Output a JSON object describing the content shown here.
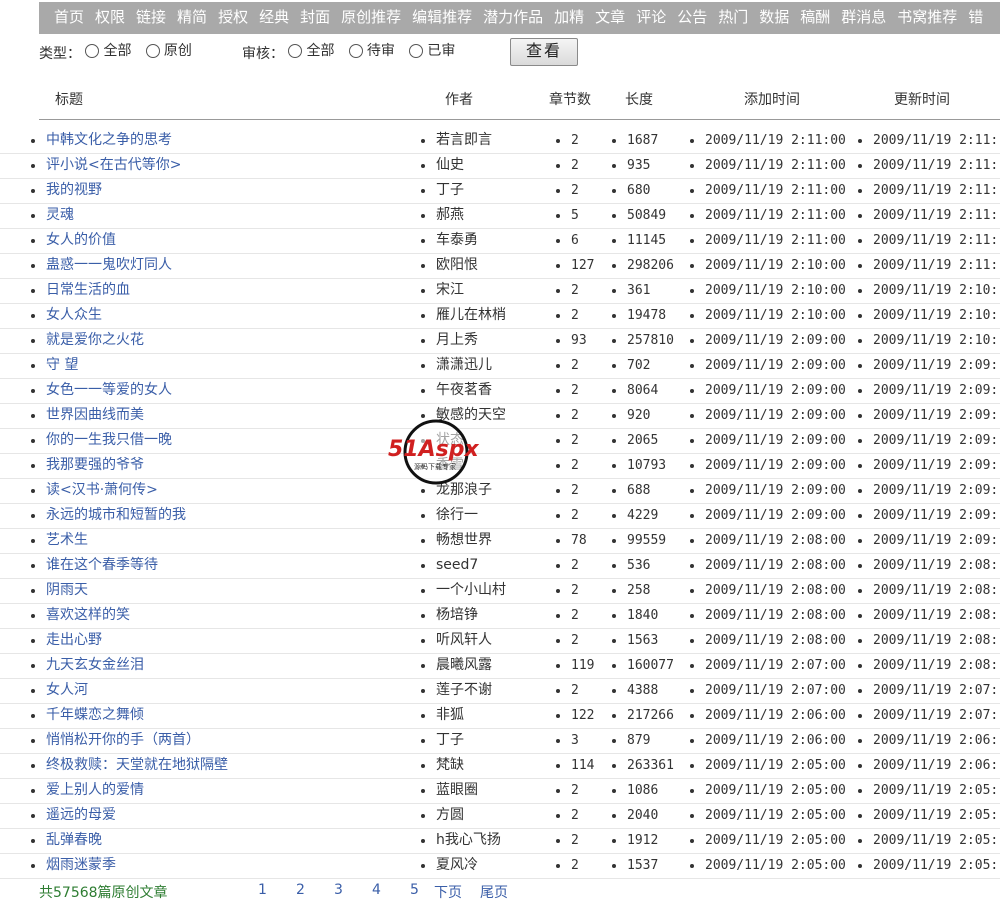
{
  "nav": [
    "首页",
    "权限",
    "链接",
    "精简",
    "授权",
    "经典",
    "封面",
    "原创推荐",
    "编辑推荐",
    "潜力作品",
    "加精",
    "文章",
    "评论",
    "公告",
    "热门",
    "数据",
    "稿酬",
    "群消息",
    "书窝推荐",
    "错"
  ],
  "filters": {
    "type_label": "类型：",
    "type_options": [
      "全部",
      "原创"
    ],
    "review_label": "审核：",
    "review_options": [
      "全部",
      "待审",
      "已审"
    ],
    "view_button": "查看"
  },
  "headers": {
    "title": "标题",
    "author": "作者",
    "chapters": "章节数",
    "length": "长度",
    "added": "添加时间",
    "updated": "更新时间"
  },
  "rows": [
    {
      "title": "中韩文化之争的思考",
      "author": "若言即言",
      "chapters": "2",
      "length": "1687",
      "added": "2009/11/19 2:11:00",
      "updated": "2009/11/19 2:11:"
    },
    {
      "title": "评小说<在古代等你>",
      "author": "仙史",
      "chapters": "2",
      "length": "935",
      "added": "2009/11/19 2:11:00",
      "updated": "2009/11/19 2:11:"
    },
    {
      "title": "我的视野",
      "author": "丁子",
      "chapters": "2",
      "length": "680",
      "added": "2009/11/19 2:11:00",
      "updated": "2009/11/19 2:11:"
    },
    {
      "title": "灵魂",
      "author": "郝燕",
      "chapters": "5",
      "length": "50849",
      "added": "2009/11/19 2:11:00",
      "updated": "2009/11/19 2:11:"
    },
    {
      "title": "女人的价值",
      "author": "车泰勇",
      "chapters": "6",
      "length": "11145",
      "added": "2009/11/19 2:11:00",
      "updated": "2009/11/19 2:11:"
    },
    {
      "title": "蛊惑一一鬼吹灯同人",
      "author": "欧阳恨",
      "chapters": "127",
      "length": "298206",
      "added": "2009/11/19 2:10:00",
      "updated": "2009/11/19 2:11:"
    },
    {
      "title": "日常生活的血",
      "author": "宋江",
      "chapters": "2",
      "length": "361",
      "added": "2009/11/19 2:10:00",
      "updated": "2009/11/19 2:10:"
    },
    {
      "title": "女人众生",
      "author": "雁儿在林梢",
      "chapters": "2",
      "length": "19478",
      "added": "2009/11/19 2:10:00",
      "updated": "2009/11/19 2:10:"
    },
    {
      "title": "就是爱你之火花",
      "author": "月上秀",
      "chapters": "93",
      "length": "257810",
      "added": "2009/11/19 2:09:00",
      "updated": "2009/11/19 2:10:"
    },
    {
      "title": "守 望",
      "author": "潇潇迅儿",
      "chapters": "2",
      "length": "702",
      "added": "2009/11/19 2:09:00",
      "updated": "2009/11/19 2:09:"
    },
    {
      "title": "女色一一等爱的女人",
      "author": "午夜茗香",
      "chapters": "2",
      "length": "8064",
      "added": "2009/11/19 2:09:00",
      "updated": "2009/11/19 2:09:"
    },
    {
      "title": "世界因曲线而美",
      "author": "敏感的天空",
      "chapters": "2",
      "length": "920",
      "added": "2009/11/19 2:09:00",
      "updated": "2009/11/19 2:09:"
    },
    {
      "title": "你的一生我只借一晚",
      "author": "状态",
      "chapters": "2",
      "length": "2065",
      "added": "2009/11/19 2:09:00",
      "updated": "2009/11/19 2:09:"
    },
    {
      "title": "我那要强的爷爷",
      "author": "香雪",
      "chapters": "2",
      "length": "10793",
      "added": "2009/11/19 2:09:00",
      "updated": "2009/11/19 2:09:"
    },
    {
      "title": "读<汉书·萧何传>",
      "author": "龙那浪子",
      "chapters": "2",
      "length": "688",
      "added": "2009/11/19 2:09:00",
      "updated": "2009/11/19 2:09:"
    },
    {
      "title": "永远的城市和短暂的我",
      "author": "徐行一",
      "chapters": "2",
      "length": "4229",
      "added": "2009/11/19 2:09:00",
      "updated": "2009/11/19 2:09:"
    },
    {
      "title": "艺术生",
      "author": "畅想世界",
      "chapters": "78",
      "length": "99559",
      "added": "2009/11/19 2:08:00",
      "updated": "2009/11/19 2:09:"
    },
    {
      "title": "谁在这个春季等待",
      "author": "seed7",
      "chapters": "2",
      "length": "536",
      "added": "2009/11/19 2:08:00",
      "updated": "2009/11/19 2:08:"
    },
    {
      "title": "阴雨天",
      "author": "一个小山村",
      "chapters": "2",
      "length": "258",
      "added": "2009/11/19 2:08:00",
      "updated": "2009/11/19 2:08:"
    },
    {
      "title": "喜欢这样的笑",
      "author": "杨培铮",
      "chapters": "2",
      "length": "1840",
      "added": "2009/11/19 2:08:00",
      "updated": "2009/11/19 2:08:"
    },
    {
      "title": "走出心野",
      "author": "听风轩人",
      "chapters": "2",
      "length": "1563",
      "added": "2009/11/19 2:08:00",
      "updated": "2009/11/19 2:08:"
    },
    {
      "title": "九天玄女金丝泪",
      "author": "晨曦风露",
      "chapters": "119",
      "length": "160077",
      "added": "2009/11/19 2:07:00",
      "updated": "2009/11/19 2:08:"
    },
    {
      "title": "女人河",
      "author": "莲子不谢",
      "chapters": "2",
      "length": "4388",
      "added": "2009/11/19 2:07:00",
      "updated": "2009/11/19 2:07:"
    },
    {
      "title": "千年蝶恋之舞倾",
      "author": "非狐",
      "chapters": "122",
      "length": "217266",
      "added": "2009/11/19 2:06:00",
      "updated": "2009/11/19 2:07:"
    },
    {
      "title": "悄悄松开你的手（两首）",
      "author": "丁子",
      "chapters": "3",
      "length": "879",
      "added": "2009/11/19 2:06:00",
      "updated": "2009/11/19 2:06:"
    },
    {
      "title": "终极救赎：天堂就在地狱隔壁",
      "author": "梵缺",
      "chapters": "114",
      "length": "263361",
      "added": "2009/11/19 2:05:00",
      "updated": "2009/11/19 2:06:"
    },
    {
      "title": "爱上别人的爱情",
      "author": "蓝眼圈",
      "chapters": "2",
      "length": "1086",
      "added": "2009/11/19 2:05:00",
      "updated": "2009/11/19 2:05:"
    },
    {
      "title": "遥远的母爱",
      "author": "方圆",
      "chapters": "2",
      "length": "2040",
      "added": "2009/11/19 2:05:00",
      "updated": "2009/11/19 2:05:"
    },
    {
      "title": "乱弹春晚",
      "author": "h我心飞扬",
      "chapters": "2",
      "length": "1912",
      "added": "2009/11/19 2:05:00",
      "updated": "2009/11/19 2:05:"
    },
    {
      "title": "烟雨迷蒙季",
      "author": "夏风冷",
      "chapters": "2",
      "length": "1537",
      "added": "2009/11/19 2:05:00",
      "updated": "2009/11/19 2:05:"
    }
  ],
  "footer": {
    "total": "共57568篇原创文章",
    "pages": [
      "1",
      "2",
      "3",
      "4",
      "5"
    ],
    "next": "下页",
    "last": "尾页"
  },
  "watermark": {
    "text": "51Aspx",
    "subtext": "源码下载专家"
  }
}
